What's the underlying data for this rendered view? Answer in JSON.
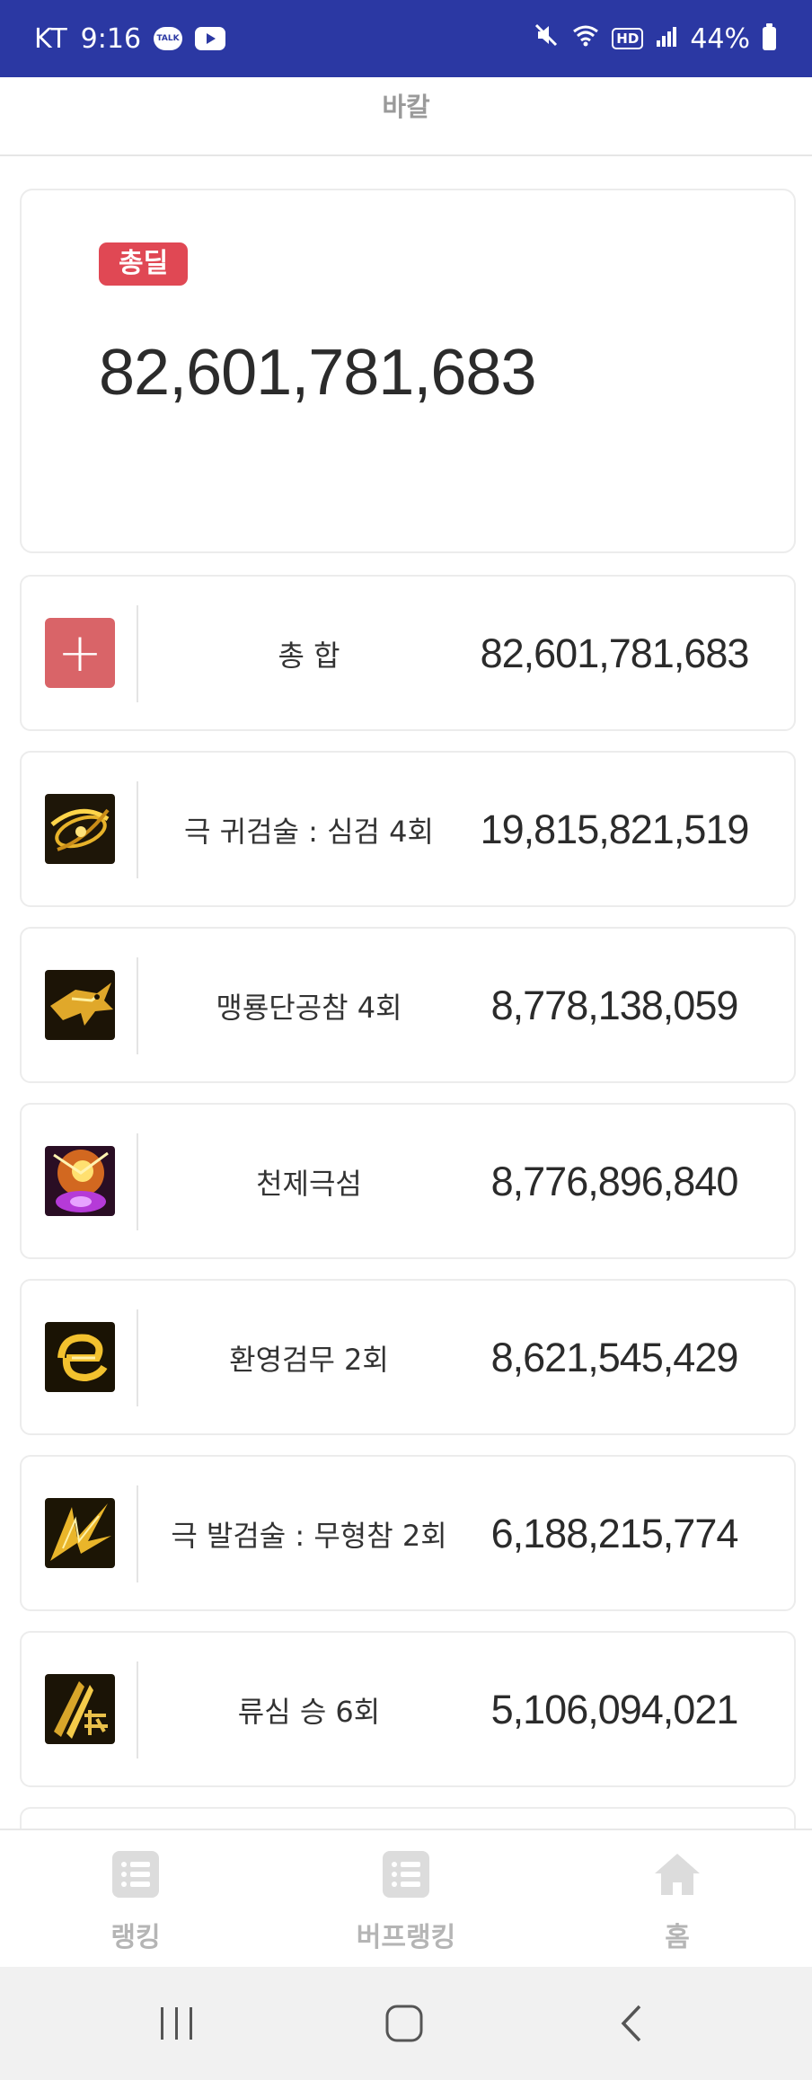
{
  "status_bar": {
    "carrier": "KT",
    "time": "9:16",
    "talk_badge": "TALK",
    "hd": "HD",
    "battery": "44%"
  },
  "top_bar": {
    "title": "바칼"
  },
  "summary": {
    "badge": "총딜",
    "total": "82,601,781,683"
  },
  "skills": [
    {
      "name": "총 합",
      "damage": "82,601,781,683",
      "icon": "plus-icon"
    },
    {
      "name": "극 귀검술 : 심검 4회",
      "damage": "19,815,821,519",
      "icon": "sword-swirl-icon"
    },
    {
      "name": "맹룡단공참 4회",
      "damage": "8,778,138,059",
      "icon": "dragon-icon"
    },
    {
      "name": "천제극섬",
      "damage": "8,776,896,840",
      "icon": "flash-icon"
    },
    {
      "name": "환영검무 2회",
      "damage": "8,621,545,429",
      "icon": "phantom-blade-icon"
    },
    {
      "name": "극 발검술 : 무형참 2회",
      "damage": "6,188,215,774",
      "icon": "slash-burst-icon"
    },
    {
      "name": "류심 승 6회",
      "damage": "5,106,094,021",
      "icon": "ryusim-icon"
    }
  ],
  "bottom_nav": {
    "items": [
      {
        "label": "랭킹",
        "icon": "list-icon"
      },
      {
        "label": "버프랭킹",
        "icon": "list-icon"
      },
      {
        "label": "홈",
        "icon": "home-icon"
      }
    ]
  },
  "system_nav": {
    "icons": [
      "recent-apps-icon",
      "home-button-icon",
      "back-icon"
    ]
  },
  "colors": {
    "status_bar": "#2b38a3",
    "badge": "#e04854",
    "plus_tile": "#d96468"
  }
}
